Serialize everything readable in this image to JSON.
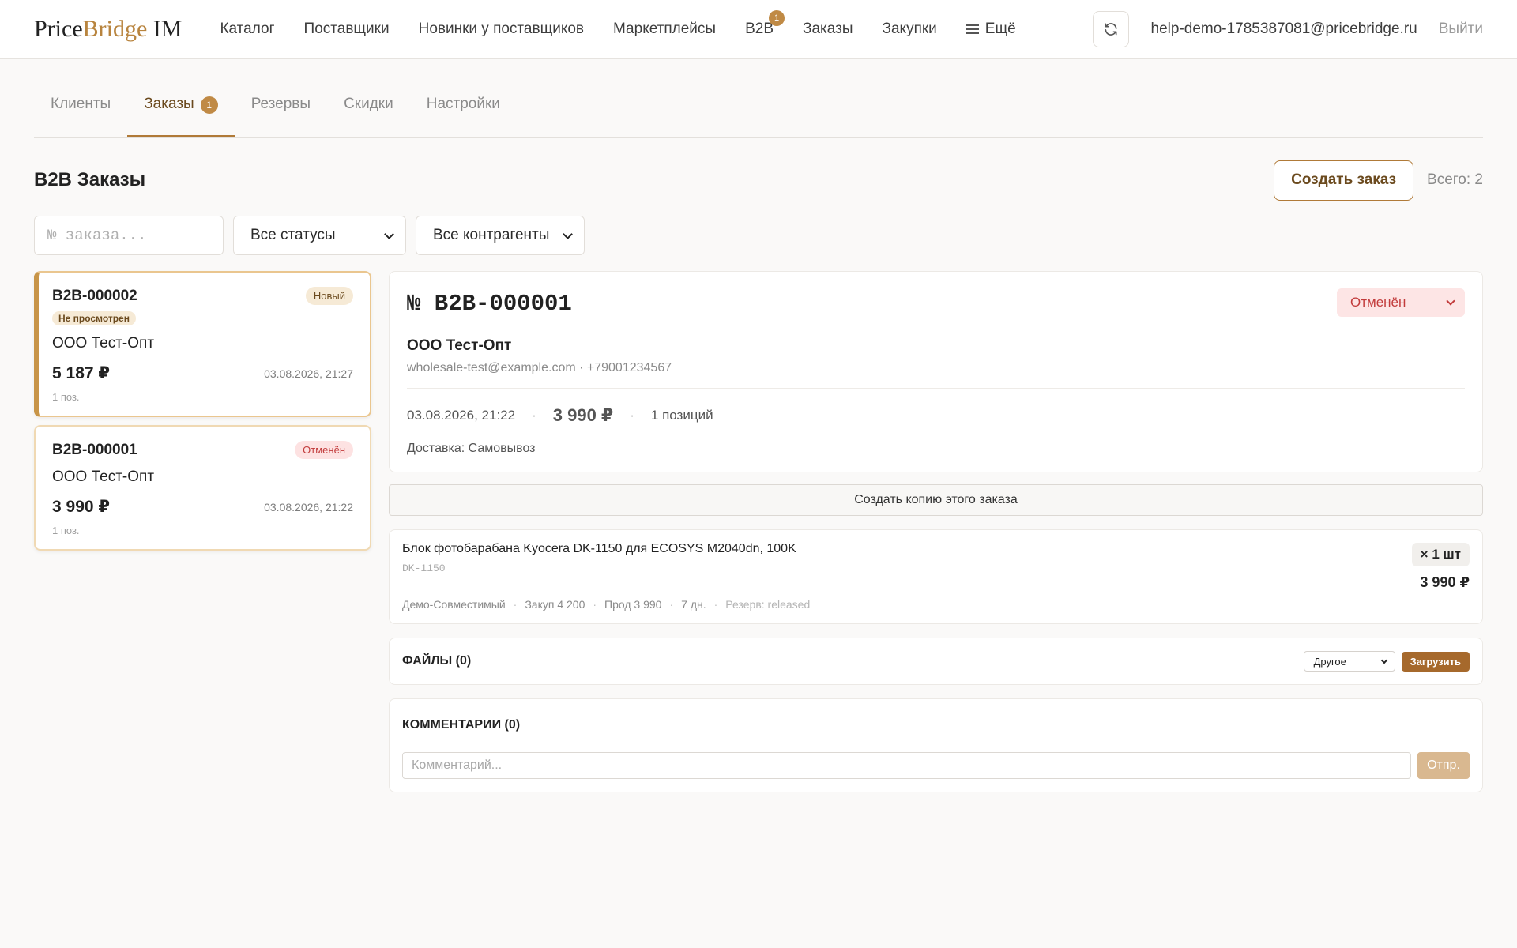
{
  "header": {
    "logo_part1": "Price",
    "logo_part2": "Bridge",
    "logo_part3": " IM",
    "nav": [
      {
        "label": "Каталог"
      },
      {
        "label": "Поставщики"
      },
      {
        "label": "Новинки у поставщиков"
      },
      {
        "label": "Маркетплейсы"
      },
      {
        "label": "B2B",
        "badge": "1"
      },
      {
        "label": "Заказы"
      },
      {
        "label": "Закупки"
      },
      {
        "label": "Ещё"
      }
    ],
    "user_email": "help-demo-1785387081@pricebridge.ru",
    "logout": "Выйти"
  },
  "tabs": [
    {
      "label": "Клиенты"
    },
    {
      "label": "Заказы",
      "count": "1"
    },
    {
      "label": "Резервы"
    },
    {
      "label": "Скидки"
    },
    {
      "label": "Настройки"
    }
  ],
  "title": "B2B Заказы",
  "create_label": "Создать заказ",
  "total": "Всего: 2",
  "filters": {
    "search_placeholder": "№ заказа...",
    "status": "Все статусы",
    "counterparty": "Все контрагенты"
  },
  "orders": [
    {
      "number": "B2B-000002",
      "status": "Новый",
      "unseen": "Не просмотрен",
      "client": "ООО Тест-Опт",
      "sum": "5 187 ₽",
      "date": "03.08.2026, 21:27",
      "positions": "1 поз."
    },
    {
      "number": "B2B-000001",
      "status": "Отменён",
      "client": "ООО Тест-Опт",
      "sum": "3 990 ₽",
      "date": "03.08.2026, 21:22",
      "positions": "1 поз."
    }
  ],
  "detail": {
    "number": "№ B2B-000001",
    "status": "Отменён",
    "client": "ООО Тест-Опт",
    "contact": "wholesale-test@example.com · +79001234567",
    "date": "03.08.2026, 21:22",
    "sum": "3 990 ₽",
    "positions": "1 позиций",
    "delivery": "Доставка: Самовывоз"
  },
  "copy_label": "Создать копию этого заказа",
  "item": {
    "name": "Блок фотобарабана Kyocera DK-1150 для ECOSYS M2040dn, 100K",
    "sku": "DK-1150",
    "qty": "× 1 шт",
    "price": "3 990 ₽",
    "supplier": "Демо-Совместимый",
    "purchase": "Закуп 4 200",
    "sale": "Прод 3 990",
    "days": "7 дн.",
    "reserve": "Резерв: released"
  },
  "files": {
    "title": "ФАЙЛЫ (0)",
    "type": "Другое",
    "upload": "Загрузить"
  },
  "comments": {
    "title": "КОММЕНТАРИИ (0)",
    "placeholder": "Комментарий...",
    "send": "Отпр."
  },
  "colors": {
    "accent": "#b07a38",
    "badge": "#c08a45",
    "cancel": "#c23b3b",
    "cancel_bg": "#fde5e5"
  }
}
